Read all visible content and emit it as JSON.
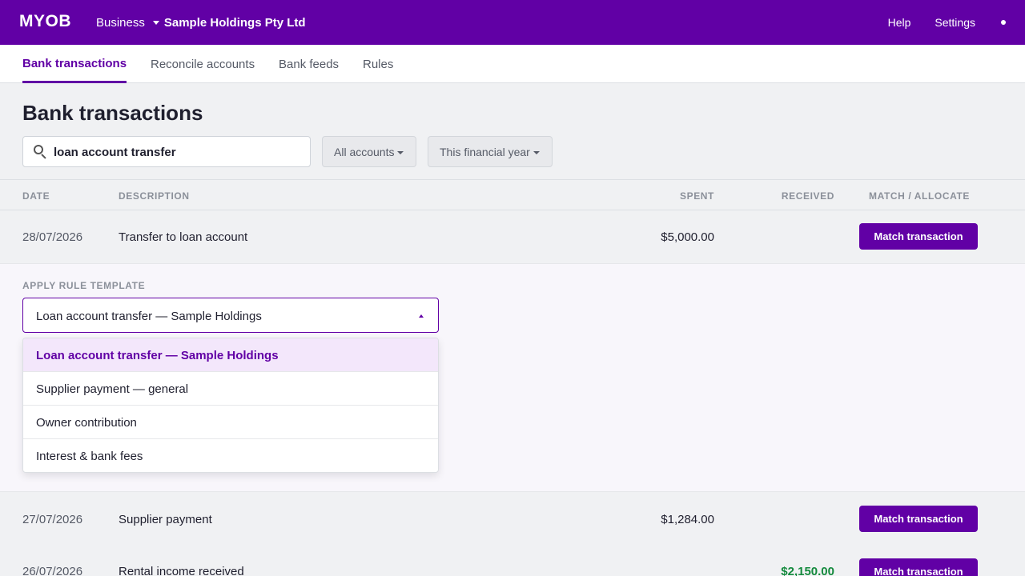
{
  "topbar": {
    "logo": "MYOB",
    "business_label": "Business",
    "business_name": "Sample Holdings Pty Ltd",
    "help": "Help",
    "settings": "Settings"
  },
  "tabs": {
    "bank_transactions": "Bank transactions",
    "reconcile_accounts": "Reconcile accounts",
    "bank_feeds": "Bank feeds",
    "rules": "Rules"
  },
  "page": {
    "title": "Bank transactions"
  },
  "search": {
    "value": "loan account transfer"
  },
  "filters": {
    "accounts": "All accounts",
    "period": "This financial year"
  },
  "table": {
    "headers": {
      "date": "DATE",
      "description": "DESCRIPTION",
      "spent": "SPENT",
      "received": "RECEIVED",
      "match": "MATCH / ALLOCATE"
    },
    "rows": [
      {
        "date": "28/07/2026",
        "description": "Transfer to loan account",
        "spent": "$5,000.00",
        "received": "",
        "action": "Match transaction"
      },
      {
        "date": "27/07/2026",
        "description": "Supplier payment",
        "spent": "$1,284.00",
        "received": "",
        "action": "Match transaction"
      },
      {
        "date": "26/07/2026",
        "description": "Rental income received",
        "spent": "",
        "received": "$2,150.00",
        "action": "Match transaction"
      }
    ]
  },
  "rule_template": {
    "label": "APPLY RULE TEMPLATE",
    "selected": "Loan account transfer — Sample Holdings",
    "options": [
      "Loan account transfer — Sample Holdings",
      "Supplier payment — general",
      "Owner contribution",
      "Interest & bank fees"
    ]
  },
  "colors": {
    "brand": "#6100a5",
    "received": "#148a3d"
  }
}
